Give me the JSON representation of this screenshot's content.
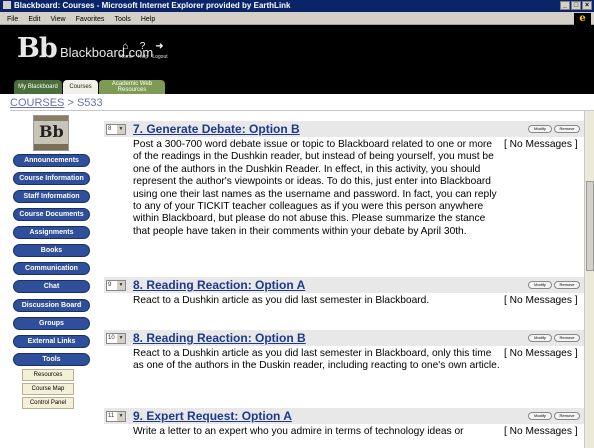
{
  "window": {
    "title": "Blackboard: Courses - Microsoft Internet Explorer provided by EarthLink",
    "controls": [
      "_",
      "□",
      "×"
    ]
  },
  "menubar": [
    "File",
    "Edit",
    "View",
    "Favorites",
    "Tools",
    "Help"
  ],
  "header": {
    "logo": "Bb",
    "site_name": "Blackboard.com",
    "icons": [
      {
        "icon": "home-icon",
        "glyph": "⌂",
        "label": "Home"
      },
      {
        "icon": "help-icon",
        "glyph": "?",
        "label": "Help"
      },
      {
        "icon": "logout-icon",
        "glyph": "➜",
        "label": "Logout"
      }
    ]
  },
  "tabs": [
    "My Blackboard",
    "Courses",
    "Academic Web Resources"
  ],
  "breadcrumb": {
    "root": "COURSES",
    "sep": ">",
    "current": "S533"
  },
  "course_image": {
    "logo": "Bb",
    "url": "www.blackboard.com"
  },
  "sidebar": {
    "buttons": [
      "Announcements",
      "Course Information",
      "Staff Information",
      "Course Documents",
      "Assignments",
      "Books",
      "Communication",
      "Chat",
      "Discussion Board",
      "Groups",
      "External Links",
      "Tools"
    ],
    "sub_buttons": [
      "Resources",
      "Course Map",
      "Control Panel"
    ]
  },
  "items": [
    {
      "order": "8",
      "title": "7. Generate Debate: Option B",
      "modify": "Modify",
      "remove": "Remove",
      "messages": "[ No Messages ]",
      "description": "Post a 300-700 word debate issue or topic to Blackboard related to one or more of the readings in the Dushkin reader, but instead of being yourself, you must be one of the authors in the Dushkin Reader. In effect, in this activity, you should represent the author's viewpoints or ideas. To do this, just enter into Blackboard using one their last names as the username and password. In fact, you can reply to any of your TICKIT teacher colleagues as if you were this person anywhere within Blackboard, but please do not abuse this. Please summarize the stance that people have taken in their comments within your debate by April 30th."
    },
    {
      "order": "9",
      "title": "8. Reading Reaction: Option A",
      "modify": "Modify",
      "remove": "Remove",
      "messages": "[ No Messages ]",
      "description": "React to a Dushkin article as you did last semester in Blackboard."
    },
    {
      "order": "10",
      "title": "8. Reading Reaction: Option B",
      "modify": "Modify",
      "remove": "Remove",
      "messages": "[ No Messages ]",
      "description": "React to a Dushkin article as you did last semester in Blackboard, only this time as one of the authors in the Duskin reader, including reacting to one's own article."
    },
    {
      "order": "11",
      "title": "9. Expert Request: Option A",
      "modify": "Modify",
      "remove": "Remove",
      "messages": "[ No Messages ]",
      "description": "Write a letter to an expert who you admire in terms of technology ideas or"
    }
  ],
  "colors": {
    "nav_button": "#2f4f9b",
    "item_title": "#1d3a8a",
    "header_bg": "#000000",
    "titlebar": "#0a246a"
  }
}
